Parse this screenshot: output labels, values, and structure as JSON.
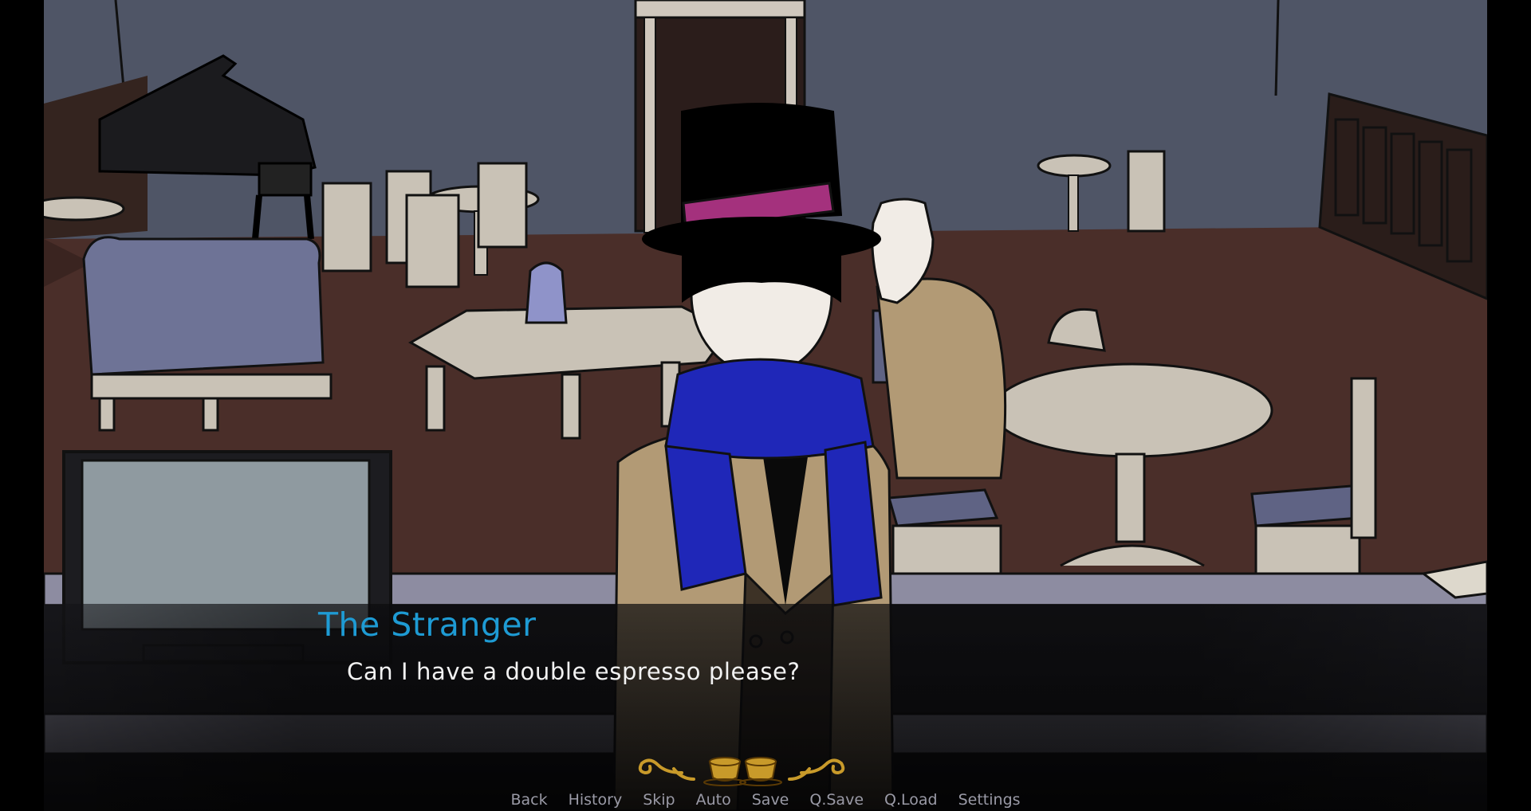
{
  "speaker": {
    "name": "The Stranger",
    "color": "#1e9bd4"
  },
  "dialogue": {
    "text": "Can I have a double espresso please?"
  },
  "quick_menu": {
    "items": [
      "Back",
      "History",
      "Skip",
      "Auto",
      "Save",
      "Q.Save",
      "Q.Load",
      "Settings"
    ]
  },
  "ornament": {
    "icon": "coffee-cups-ornament-icon",
    "color": "#c89a2a"
  }
}
